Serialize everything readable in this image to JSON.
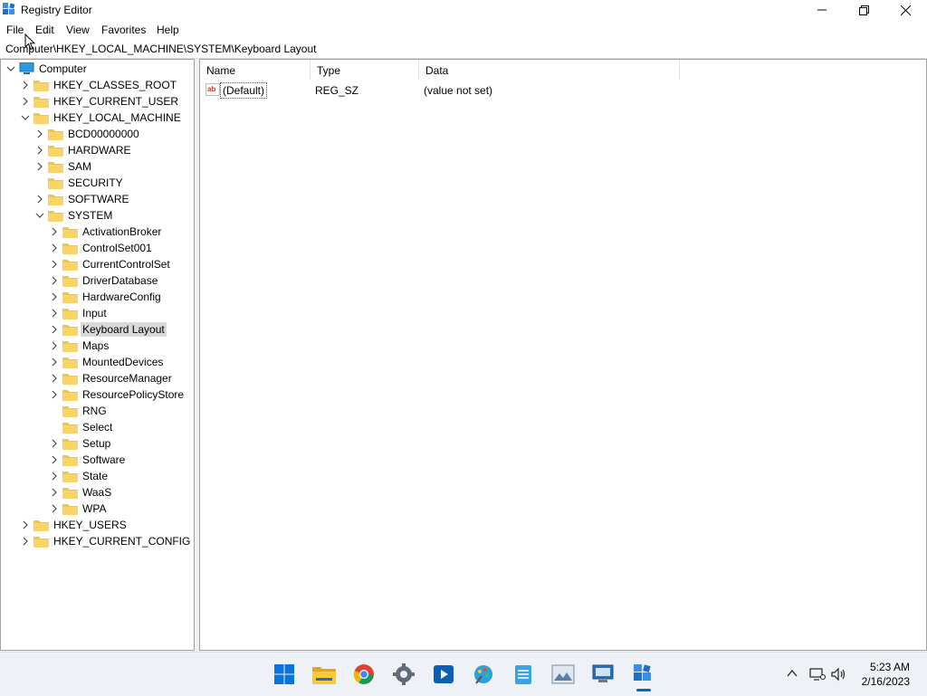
{
  "window": {
    "title": "Registry Editor"
  },
  "menu": [
    "File",
    "Edit",
    "View",
    "Favorites",
    "Help"
  ],
  "address": "Computer\\HKEY_LOCAL_MACHINE\\SYSTEM\\Keyboard Layout",
  "tree": {
    "root": "Computer",
    "hives": [
      "HKEY_CLASSES_ROOT",
      "HKEY_CURRENT_USER",
      "HKEY_LOCAL_MACHINE",
      "HKEY_USERS",
      "HKEY_CURRENT_CONFIG"
    ],
    "hklm_children": [
      "BCD00000000",
      "HARDWARE",
      "SAM",
      "SECURITY",
      "SOFTWARE",
      "SYSTEM"
    ],
    "system_children": [
      "ActivationBroker",
      "ControlSet001",
      "CurrentControlSet",
      "DriverDatabase",
      "HardwareConfig",
      "Input",
      "Keyboard Layout",
      "Maps",
      "MountedDevices",
      "ResourceManager",
      "ResourcePolicyStore",
      "RNG",
      "Select",
      "Setup",
      "Software",
      "State",
      "WaaS",
      "WPA"
    ],
    "selected": "Keyboard Layout"
  },
  "list": {
    "columns": [
      "Name",
      "Type",
      "Data"
    ],
    "rows": [
      {
        "name": "(Default)",
        "type": "REG_SZ",
        "data": "(value not set)"
      }
    ]
  },
  "taskbar": {
    "icons": [
      "windows-start-icon",
      "file-explorer-icon",
      "chrome-icon",
      "settings-icon",
      "media-player-icon",
      "paint-icon",
      "notepad-icon",
      "photos-icon",
      "remote-desktop-icon",
      "registry-editor-icon"
    ],
    "clock": {
      "time": "5:23 AM",
      "date": "2/16/2023"
    }
  },
  "colors": {
    "accent": "#0067c0",
    "folder": "#f4c542",
    "selection": "#d9d9d9"
  }
}
